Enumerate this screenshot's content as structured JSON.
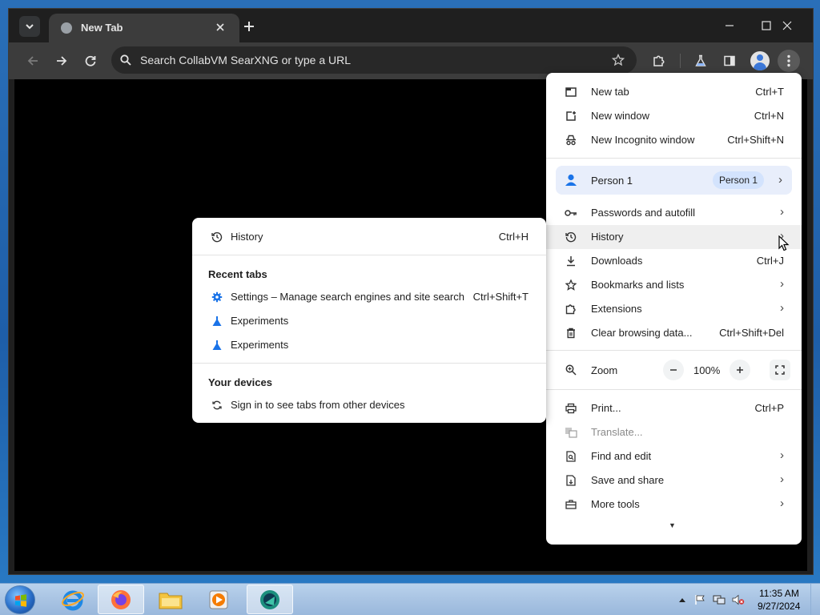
{
  "browser": {
    "tab_title": "New Tab",
    "omnibox_placeholder": "Search CollabVM SearXNG or type a URL"
  },
  "main_menu": {
    "items_top": [
      {
        "label": "New tab",
        "shortcut": "Ctrl+T"
      },
      {
        "label": "New window",
        "shortcut": "Ctrl+N"
      },
      {
        "label": "New Incognito window",
        "shortcut": "Ctrl+Shift+N"
      }
    ],
    "person": {
      "label": "Person 1",
      "badge": "Person 1"
    },
    "items_mid": [
      {
        "label": "Passwords and autofill",
        "shortcut": ""
      },
      {
        "label": "History",
        "shortcut": ""
      },
      {
        "label": "Downloads",
        "shortcut": "Ctrl+J"
      },
      {
        "label": "Bookmarks and lists",
        "shortcut": ""
      },
      {
        "label": "Extensions",
        "shortcut": ""
      },
      {
        "label": "Clear browsing data...",
        "shortcut": "Ctrl+Shift+Del"
      }
    ],
    "zoom": {
      "label": "Zoom",
      "value": "100%"
    },
    "items_bottom": [
      {
        "label": "Print...",
        "shortcut": "Ctrl+P"
      },
      {
        "label": "Translate...",
        "shortcut": ""
      },
      {
        "label": "Find and edit",
        "shortcut": ""
      },
      {
        "label": "Save and share",
        "shortcut": ""
      },
      {
        "label": "More tools",
        "shortcut": ""
      }
    ]
  },
  "history_menu": {
    "history": {
      "label": "History",
      "shortcut": "Ctrl+H"
    },
    "recent_title": "Recent tabs",
    "recent": [
      {
        "label": "Settings – Manage search engines and site search",
        "shortcut": "Ctrl+Shift+T"
      },
      {
        "label": "Experiments",
        "shortcut": ""
      },
      {
        "label": "Experiments",
        "shortcut": ""
      }
    ],
    "devices_title": "Your devices",
    "devices_item": "Sign in to see tabs from other devices"
  },
  "taskbar": {
    "time": "11:35 AM",
    "date": "9/27/2024"
  },
  "colors": {
    "accent": "#1a73e8",
    "browser_frame": "#1f1f1f",
    "toolbar": "#3c3c3c",
    "page_background": "#000000"
  },
  "icons": [
    "chevron-down-icon",
    "globe-icon",
    "close-icon",
    "plus-icon",
    "minimize-icon",
    "maximize-icon",
    "back-icon",
    "forward-icon",
    "reload-icon",
    "search-icon",
    "star-icon",
    "puzzle-icon",
    "flask-icon",
    "sidepanel-icon",
    "avatar",
    "kebab-menu-icon"
  ]
}
